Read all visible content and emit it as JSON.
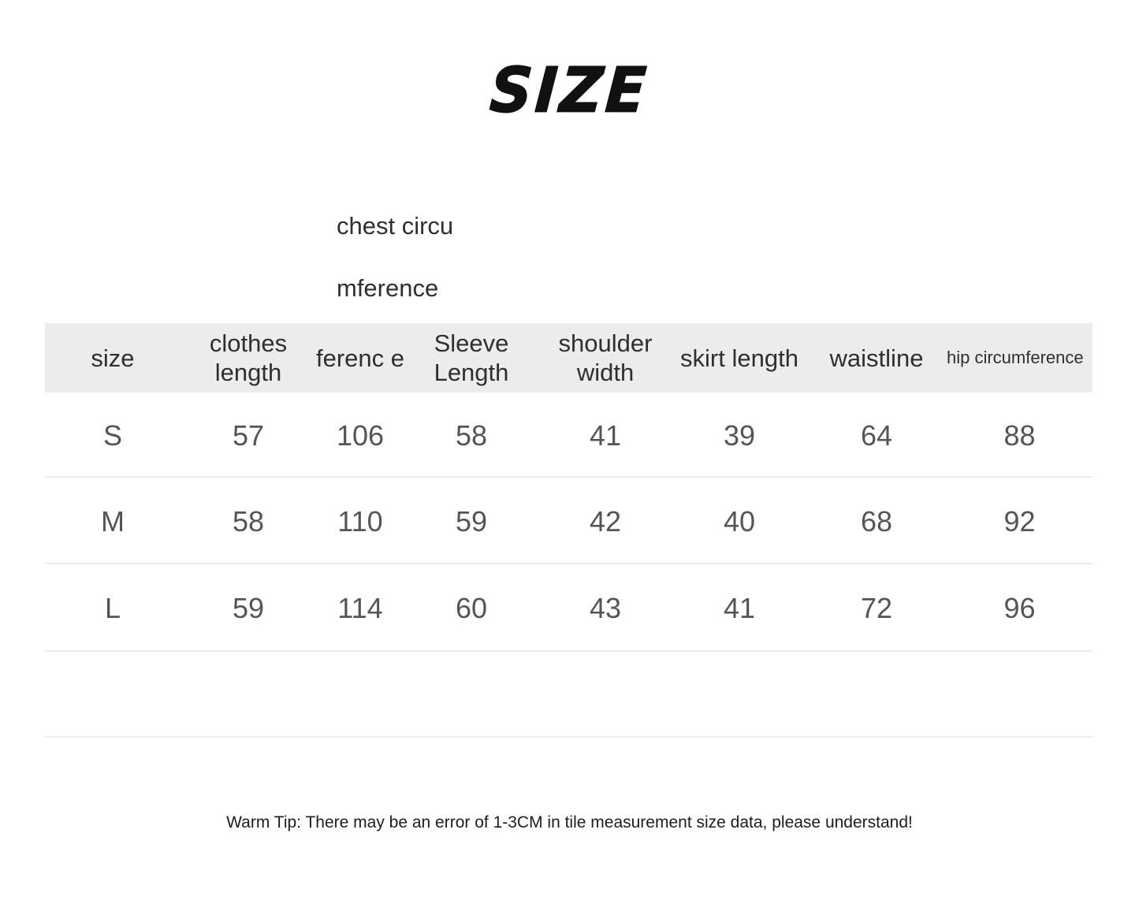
{
  "title": "SIZE",
  "table": {
    "overflow_text": "chest circumference",
    "headers": [
      {
        "key": "size",
        "label": "size",
        "align": "center",
        "size": "normal"
      },
      {
        "key": "clothes_length",
        "label": "clothes length",
        "align": "center",
        "size": "normal"
      },
      {
        "key": "chest_circumference",
        "label": "chest circumference",
        "align": "left",
        "size": "normal"
      },
      {
        "key": "sleeve_length",
        "label": "Sleeve Length",
        "align": "center",
        "size": "normal"
      },
      {
        "key": "shoulder_width",
        "label": "shoulder width",
        "align": "center",
        "size": "normal"
      },
      {
        "key": "skirt_length",
        "label": "skirt length",
        "align": "center",
        "size": "normal"
      },
      {
        "key": "waistline",
        "label": "waistline",
        "align": "center",
        "size": "normal"
      },
      {
        "key": "hip_circumference",
        "label": "hip circumference",
        "align": "left",
        "size": "small"
      }
    ],
    "header_labels": {
      "size": "size",
      "clothes_length": "clothes length",
      "chest_circumference_visible": "ferenc e",
      "sleeve_length": "Sleeve Length",
      "shoulder_width": "shoulder width",
      "skirt_length": "skirt length",
      "waistline": "waistline",
      "hip_circumference": "hip circumference"
    },
    "rows": [
      {
        "size": "S",
        "clothes_length": "57",
        "chest_circumference": "106",
        "sleeve_length": "58",
        "shoulder_width": "41",
        "skirt_length": "39",
        "waistline": "64",
        "hip_circumference": "88"
      },
      {
        "size": "M",
        "clothes_length": "58",
        "chest_circumference": "110",
        "sleeve_length": "59",
        "shoulder_width": "42",
        "skirt_length": "40",
        "waistline": "68",
        "hip_circumference": "92"
      },
      {
        "size": "L",
        "clothes_length": "59",
        "chest_circumference": "114",
        "sleeve_length": "60",
        "shoulder_width": "43",
        "skirt_length": "41",
        "waistline": "72",
        "hip_circumference": "96"
      }
    ]
  },
  "footer": {
    "tip": "Warm Tip: There may be an error of 1-3CM in tile measurement size data, please understand!"
  },
  "colors": {
    "page_background": "#ffffff",
    "header_background": "#ececec",
    "header_text": "#2f2f2f",
    "value_text": "#555555",
    "divider": "#ebebeb",
    "title_text": "#111111",
    "footer_text": "#1d1d1d"
  },
  "chart_data": {
    "type": "table",
    "title": "SIZE",
    "columns": [
      "size",
      "clothes length",
      "chest circumference",
      "Sleeve Length",
      "shoulder width",
      "skirt length",
      "waistline",
      "hip circumference"
    ],
    "units": "CM",
    "rows": [
      [
        "S",
        57,
        106,
        58,
        41,
        39,
        64,
        88
      ],
      [
        "M",
        58,
        110,
        59,
        42,
        40,
        68,
        92
      ],
      [
        "L",
        59,
        114,
        60,
        43,
        41,
        72,
        96
      ]
    ],
    "note": "Warm Tip: There may be an error of 1-3CM in tile measurement size data, please understand!"
  }
}
